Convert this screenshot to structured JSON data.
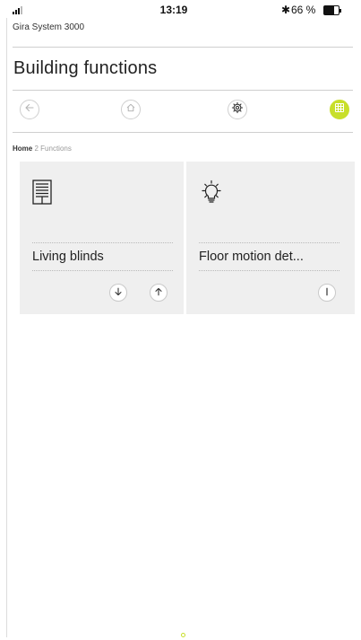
{
  "status_bar": {
    "time": "13:19",
    "bluetooth_symbol": "✱",
    "battery_text": "66 %",
    "battery_level": 0.66
  },
  "app": {
    "system_name": "Gira System 3000",
    "page_title": "Building functions"
  },
  "nav": {
    "icons": [
      "back-arrow-icon",
      "home-icon",
      "settings-gear-icon",
      "grid-icon"
    ],
    "active": "grid-icon",
    "accent_color": "#c8df2a"
  },
  "breadcrumb": {
    "home": "Home",
    "count": "2",
    "section": "Functions"
  },
  "tiles": [
    {
      "name": "Living blinds",
      "icon": "blinds-icon",
      "controls": [
        "down-arrow-icon",
        "up-arrow-icon"
      ]
    },
    {
      "name": "Floor motion det...",
      "icon": "light-bulb-icon",
      "controls": [
        "toggle-icon"
      ]
    }
  ]
}
